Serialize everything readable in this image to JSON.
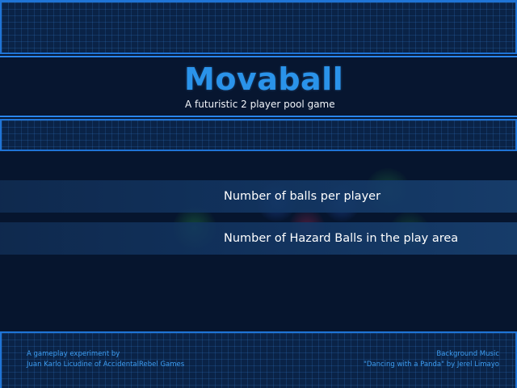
{
  "title": "Movaball",
  "subtitle": "A futuristic 2 player pool game",
  "options": [
    {
      "label": "Number of balls per player"
    },
    {
      "label": "Number of Hazard Balls in the play area"
    }
  ],
  "credits": {
    "left": [
      "A gameplay experiment by",
      "Juan Karlo Licudine of AccidentalRebel Games"
    ],
    "right": [
      "Background Music",
      "\"Dancing with a Panda\"  by Jerel Limayo"
    ]
  },
  "colors": {
    "background": "#06152e",
    "grid_panel": "#0a2347",
    "frame_border": "#1f74d6",
    "title": "#2a93ea",
    "credit_text": "#3d9cf0",
    "option_text": "#ffffff"
  }
}
